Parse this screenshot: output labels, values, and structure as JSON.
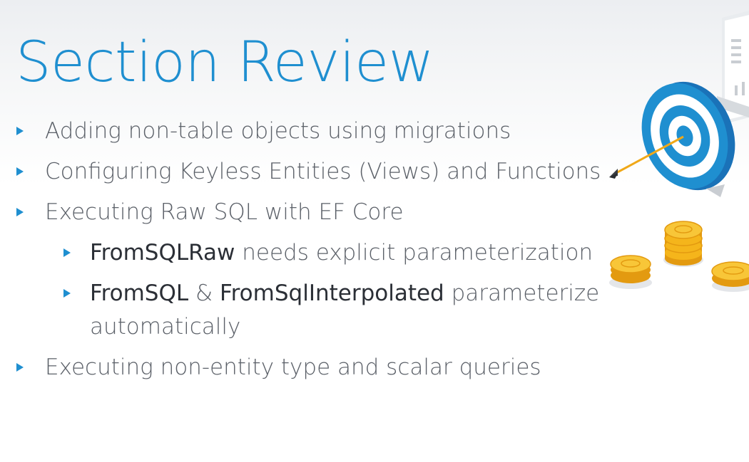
{
  "slide": {
    "title": "Section Review",
    "bullets": [
      "Adding non-table objects using migrations",
      "Configuring Keyless Entities (Views) and Functions",
      "Executing Raw SQL with EF Core"
    ],
    "sub1": {
      "keyword": "FromSQLRaw",
      "rest": " needs explicit parameterization"
    },
    "sub2": {
      "keyword1": "FromSQL",
      "amp": " & ",
      "keyword2": "FromSqlInterpolated",
      "rest": " parameterize",
      "wrap": "automatically"
    },
    "last_bullet": "Executing non-entity type and scalar queries"
  },
  "colors": {
    "accent": "#1f8fd0",
    "text": "#5b6068",
    "keyword": "#2b2f36",
    "coin": "#f5b51b"
  },
  "illustration": {
    "icons": [
      "target-icon",
      "arrow-icon",
      "document-icon",
      "coin-stack-icon"
    ]
  }
}
